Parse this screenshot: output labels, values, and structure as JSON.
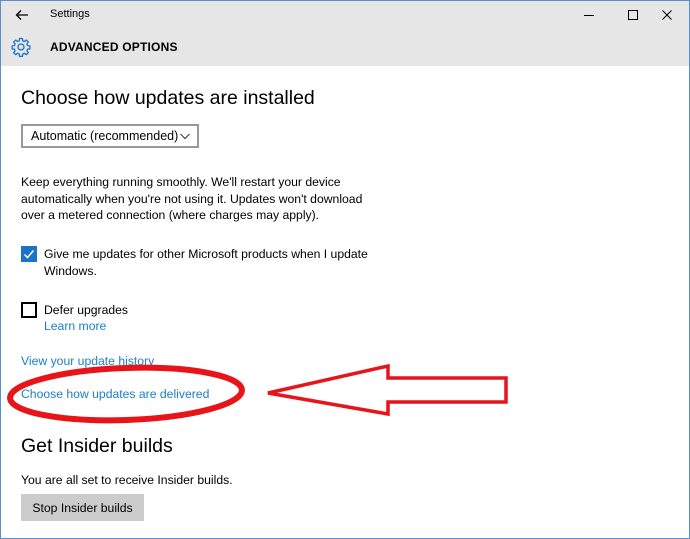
{
  "titlebar": {
    "title": "Settings"
  },
  "header": {
    "page_title": "ADVANCED OPTIONS"
  },
  "install_section": {
    "heading": "Choose how updates are installed",
    "dropdown_selected": "Automatic (recommended)",
    "description": "Keep everything running smoothly. We'll restart your device automatically when you're not using it. Updates won't download over a metered connection (where charges may apply).",
    "checkbox_other_products": {
      "label": "Give me updates for other Microsoft products when I update Windows.",
      "checked": true
    },
    "checkbox_defer": {
      "label": "Defer upgrades",
      "checked": false
    },
    "learn_more": "Learn more",
    "view_history": "View your update history",
    "choose_delivery": "Choose how updates are delivered"
  },
  "insider_section": {
    "heading": "Get Insider builds",
    "status_text": "You are all set to receive Insider builds.",
    "stop_button": "Stop Insider builds"
  },
  "colors": {
    "accent": "#1a73c8",
    "link": "#1a7ec8",
    "annotation_red": "#e8141a",
    "header_bg": "#e6e6e6",
    "button_bg": "#cccccc"
  },
  "icons": {
    "back": "back-arrow-icon",
    "settings": "gear-icon",
    "minimize": "minimize-icon",
    "maximize": "maximize-icon",
    "close": "close-icon",
    "dropdown": "chevron-down-icon",
    "checkmark": "checkmark-icon"
  }
}
